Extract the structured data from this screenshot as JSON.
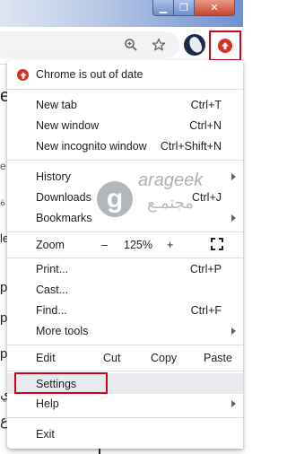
{
  "window": {
    "minimize_glyph": "▁",
    "maximize_glyph": "❐",
    "close_glyph": "✕"
  },
  "toolbar": {
    "zoom_icon": "zoom-icon",
    "bookmark_icon": "star-icon",
    "profile_icon": "avatar",
    "update_icon": "update-arrow-icon",
    "accent_red": "#d93025",
    "highlight_red": "#d0021b"
  },
  "page": {
    "fragments": [
      "e",
      "e",
      "ة",
      "le",
      "p",
      "p",
      "p",
      "ي",
      "ع"
    ]
  },
  "menu": {
    "update_notice": "Chrome is out of date",
    "new_tab": {
      "label": "New tab",
      "shortcut": "Ctrl+T"
    },
    "new_window": {
      "label": "New window",
      "shortcut": "Ctrl+N"
    },
    "new_incognito": {
      "label": "New incognito window",
      "shortcut": "Ctrl+Shift+N"
    },
    "history": {
      "label": "History"
    },
    "downloads": {
      "label": "Downloads",
      "shortcut": "Ctrl+J"
    },
    "bookmarks": {
      "label": "Bookmarks"
    },
    "zoom": {
      "label": "Zoom",
      "minus": "–",
      "level": "125%",
      "plus": "+"
    },
    "print": {
      "label": "Print...",
      "shortcut": "Ctrl+P"
    },
    "cast": {
      "label": "Cast..."
    },
    "find": {
      "label": "Find...",
      "shortcut": "Ctrl+F"
    },
    "more_tools": {
      "label": "More tools"
    },
    "edit": {
      "label": "Edit",
      "cut": "Cut",
      "copy": "Copy",
      "paste": "Paste"
    },
    "settings": {
      "label": "Settings"
    },
    "help": {
      "label": "Help"
    },
    "exit": {
      "label": "Exit"
    }
  },
  "watermark": {
    "logo_letter": "g",
    "brand": "arageek",
    "brand_arabic": "مجتمـع"
  }
}
